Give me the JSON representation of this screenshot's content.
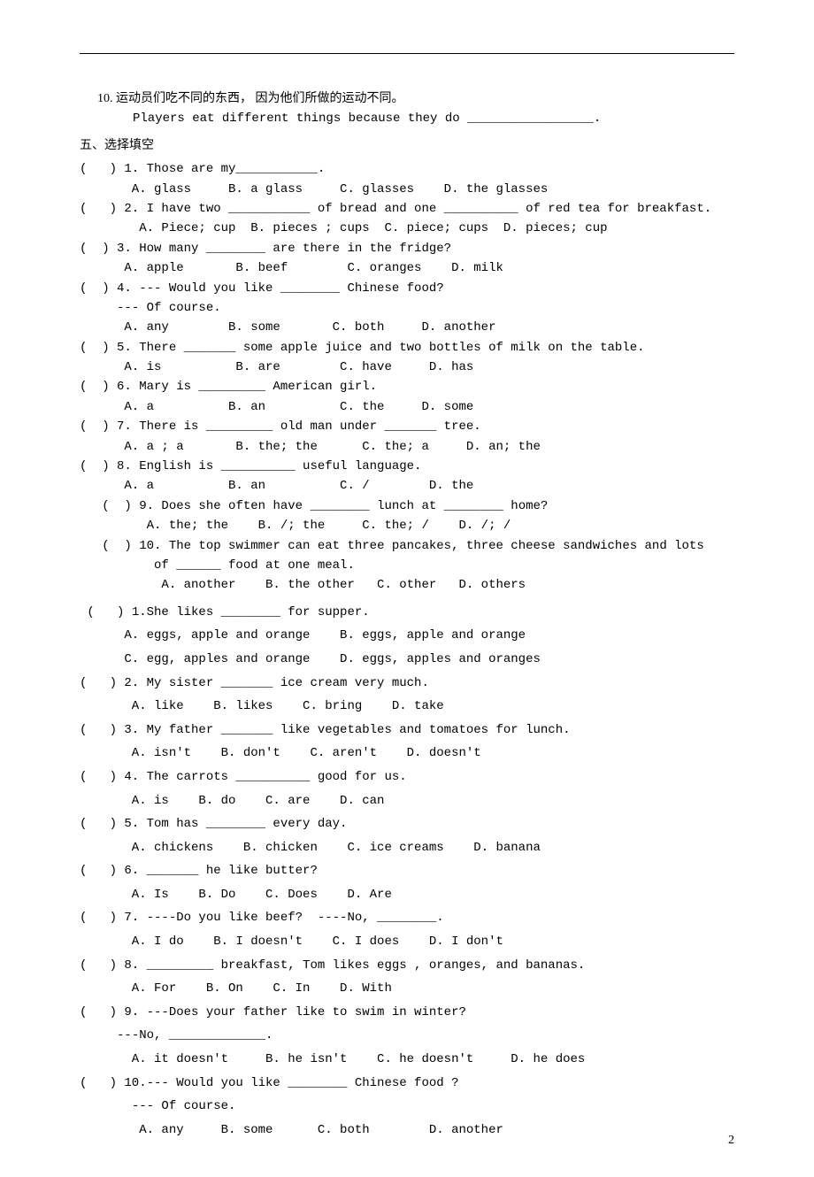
{
  "hr": "",
  "q10": {
    "num": "10.",
    "cn": "运动员们吃不同的东西， 因为他们所做的运动不同。",
    "en": "Players eat different things because they do _________________."
  },
  "sec5": "五、选择填空",
  "setA": [
    {
      "q": "(   ) 1. Those are my___________.",
      "opts": "       A. glass     B. a glass     C. glasses    D. the glasses"
    },
    {
      "q": "(   ) 2. I have two ___________ of bread and one __________ of red tea for breakfast.",
      "opts": "        A. Piece; cup  B. pieces ; cups  C. piece; cups  D. pieces; cup"
    },
    {
      "q": "(  ) 3. How many ________ are there in the fridge?",
      "opts": "      A. apple       B. beef        C. oranges    D. milk"
    },
    {
      "q": "(  ) 4. --- Would you like ________ Chinese food?",
      "q2": "     --- Of course.",
      "opts": "      A. any        B. some       C. both     D. another"
    },
    {
      "q": "(  ) 5. There _______ some apple juice and two bottles of milk on the table.",
      "opts": "      A. is          B. are        C. have     D. has"
    },
    {
      "q": "(  ) 6. Mary is _________ American girl.",
      "opts": "      A. a          B. an          C. the     D. some"
    },
    {
      "q": "(  ) 7. There is _________ old man under _______ tree.",
      "opts": "      A. a ; a       B. the; the      C. the; a     D. an; the"
    },
    {
      "q": "(  ) 8. English is __________ useful language.",
      "opts": "      A. a          B. an          C. /        D. the"
    },
    {
      "q": "   (  ) 9. Does she often have ________ lunch at ________ home?",
      "opts": "         A. the; the    B. /; the     C. the; /    D. /; /"
    },
    {
      "q": "   (  ) 10. The top swimmer can eat three pancakes, three cheese sandwiches and lots",
      "q2": "          of ______ food at one meal.",
      "opts": "           A. another    B. the other   C. other   D. others"
    }
  ],
  "setB": [
    {
      "q": " (   ) 1.She likes ________ for supper.",
      "opts1": "      A. eggs, apple and orange    B. eggs, apple and orange",
      "opts2": "      C. egg, apples and orange    D. eggs, apples and oranges"
    },
    {
      "q": "(   ) 2. My sister _______ ice cream very much.",
      "opts": "       A. like    B. likes    C. bring    D. take"
    },
    {
      "q": "(   ) 3. My father _______ like vegetables and tomatoes for lunch.",
      "opts": "       A. isn't    B. don't    C. aren't    D. doesn't"
    },
    {
      "q": "(   ) 4. The carrots __________ good for us.",
      "opts": "       A. is    B. do    C. are    D. can"
    },
    {
      "q": "(   ) 5. Tom has ________ every day.",
      "opts": "       A. chickens    B. chicken    C. ice creams    D. banana"
    },
    {
      "q": "(   ) 6. _______ he like butter?",
      "opts": "       A. Is    B. Do    C. Does    D. Are"
    },
    {
      "q": "(   ) 7. ----Do you like beef?  ----No, ________.",
      "opts": "       A. I do    B. I doesn't    C. I does    D. I don't"
    },
    {
      "q": "(   ) 8. _________ breakfast, Tom likes eggs , oranges, and bananas.",
      "opts": "       A. For    B. On    C. In    D. With"
    },
    {
      "q": "(   ) 9. ---Does your father like to swim in winter?",
      "q2": "     ---No, _____________.",
      "opts": "       A. it doesn't     B. he isn't    C. he doesn't     D. he does"
    },
    {
      "q": "(   ) 10.--- Would you like ________ Chinese food ?",
      "q2": "       --- Of course.",
      "opts": "        A. any     B. some      C. both        D. another"
    }
  ],
  "pageNum": "2"
}
